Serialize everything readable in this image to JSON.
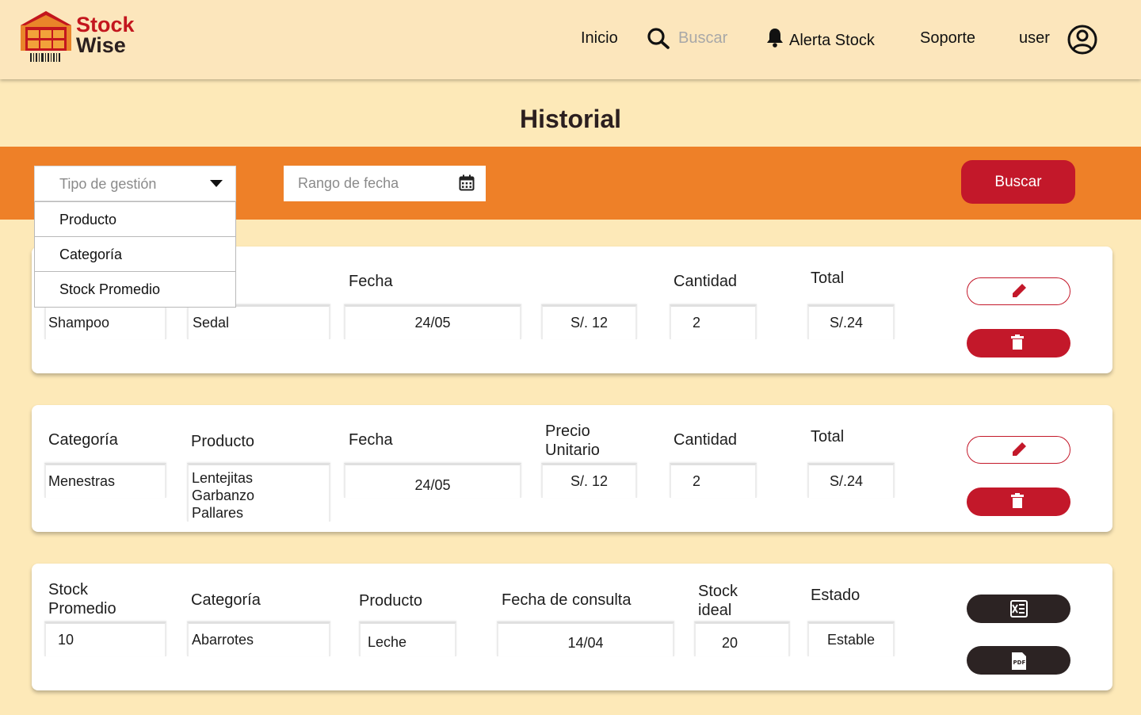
{
  "app": {
    "brand_line1": "Stock",
    "brand_line2": "Wise"
  },
  "nav": {
    "inicio": "Inicio",
    "search_placeholder": "Buscar",
    "alerta": "Alerta Stock",
    "soporte": "Soporte",
    "user": "user"
  },
  "page": {
    "title": "Historial"
  },
  "filters": {
    "tipo_placeholder": "Tipo de gestión",
    "tipo_options": [
      "Producto",
      "Categoría",
      "Stock Promedio"
    ],
    "fecha_placeholder": "Rango de fecha",
    "buscar": "Buscar"
  },
  "cards": [
    {
      "labels": {
        "fecha": "Fecha",
        "cantidad": "Cantidad",
        "total": "Total"
      },
      "values": {
        "producto": "Shampoo",
        "marca": "Sedal",
        "fecha": "24/05",
        "precio": "S/. 12",
        "cantidad": "2",
        "total": "S/.24"
      }
    },
    {
      "labels": {
        "categoria": "Categoría",
        "producto": "Producto",
        "fecha": "Fecha",
        "precio_1": "Precio",
        "precio_2": "Unitario",
        "cantidad": "Cantidad",
        "total": "Total"
      },
      "values": {
        "categoria": "Menestras",
        "producto_1": "Lentejitas",
        "producto_2": "Garbanzo",
        "producto_3": "Pallares",
        "fecha": "24/05",
        "precio": "S/. 12",
        "cantidad": "2",
        "total": "S/.24"
      }
    },
    {
      "labels": {
        "stock_1": "Stock",
        "stock_2": "Promedio",
        "categoria": "Categoría",
        "producto": "Producto",
        "fecha": "Fecha de consulta",
        "ideal_1": "Stock",
        "ideal_2": "ideal",
        "estado": "Estado"
      },
      "values": {
        "stock": "10",
        "categoria": "Abarrotes",
        "producto": "Leche",
        "fecha": "14/04",
        "ideal": "20",
        "estado": "Estable"
      }
    }
  ],
  "colors": {
    "accent_red": "#c3182a",
    "orange_bar": "#ee8028",
    "background": "#fde9b8",
    "dark_button": "#2c2323"
  },
  "icons": {
    "edit": "pencil-icon",
    "delete": "trash-icon",
    "excel": "excel-icon",
    "pdf": "pdf-icon",
    "calendar": "calendar-icon",
    "search": "search-icon",
    "bell": "bell-icon",
    "user": "user-circle-icon"
  }
}
